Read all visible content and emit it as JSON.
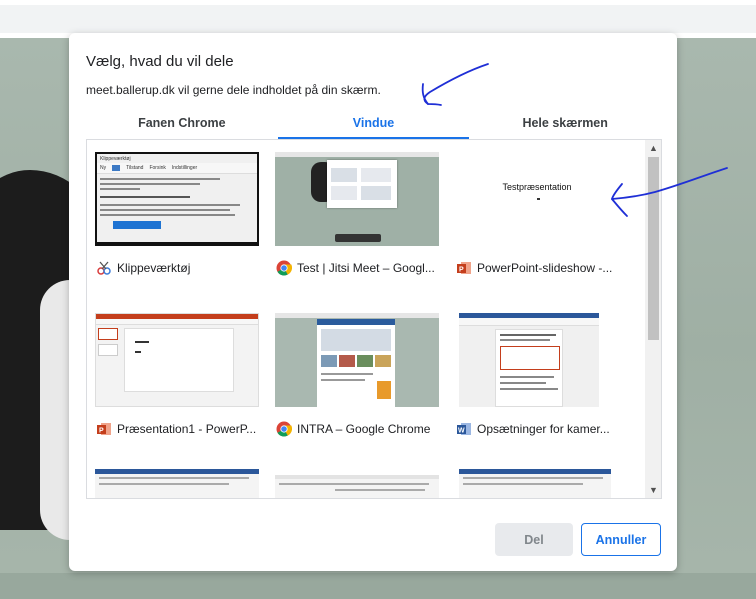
{
  "dialog": {
    "title": "Vælg, hvad du vil dele",
    "subtitle": "meet.ballerup.dk vil gerne dele indholdet på din skærm."
  },
  "tabs": [
    {
      "label": "Fanen Chrome",
      "active": false
    },
    {
      "label": "Vindue",
      "active": true
    },
    {
      "label": "Hele skærmen",
      "active": false
    }
  ],
  "windows": [
    {
      "title": "Klippeværktøj",
      "icon": "snipping-tool-icon"
    },
    {
      "title": "Test | Jitsi Meet – Googl...",
      "icon": "chrome-icon"
    },
    {
      "title": "PowerPoint-slideshow -...",
      "icon": "powerpoint-icon"
    },
    {
      "title": "Præsentation1 - PowerP...",
      "icon": "powerpoint-icon"
    },
    {
      "title": "INTRA – Google Chrome",
      "icon": "chrome-icon"
    },
    {
      "title": "Opsætninger for kamer...",
      "icon": "word-icon"
    }
  ],
  "thumbnails": {
    "snipping_title": "Klippeværktøj",
    "snipping_new": "Ny",
    "snipping_mode": "Tilstand",
    "snipping_delay": "Forsink",
    "snipping_options": "Indstillinger",
    "ppt_slideshow_text": "Testpræsentation"
  },
  "buttons": {
    "share": "Del",
    "cancel": "Annuller"
  },
  "colors": {
    "accent": "#1a73e8",
    "annotation_ink": "#1f2fd6"
  }
}
